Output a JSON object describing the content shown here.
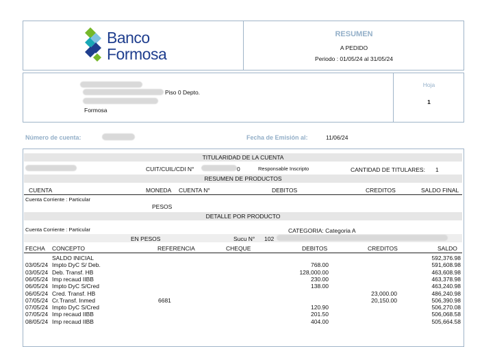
{
  "bank": {
    "line1": "Banco",
    "line2": "Formosa",
    "colors": {
      "blue": "#1f3e8e",
      "green": "#76b82a",
      "teal": "#19a7b5",
      "lightblue": "#7fc2e3"
    }
  },
  "summary": {
    "title": "RESUMEN",
    "subtitle": "A PEDIDO",
    "period": "Periodo : 01/05/24  al  31/05/24"
  },
  "address": {
    "floor": "Piso  0  Depto.",
    "city": "Formosa"
  },
  "sheet": {
    "label": "Hoja",
    "value": "1"
  },
  "account_info": {
    "account_label": "Número de cuenta:",
    "issue_label": "Fecha de Emisión al:",
    "issue_date": "11/06/24"
  },
  "ownership": {
    "title": "TITULARIDAD DE LA CUENTA",
    "cuit_label": "CUIT/CUIL/CDI N°",
    "cuit_tail": "0",
    "tax_status": "Responsable Inscripto",
    "holders_label": "CANTIDAD DE TITULARES:",
    "holders_value": "1"
  },
  "products_summary": {
    "title": "RESUMEN DE PRODUCTOS",
    "headers": {
      "account": "CUENTA",
      "currency": "MONEDA",
      "account_no": "CUENTA N°",
      "debits": "DEBITOS",
      "credits": "CREDITOS",
      "balance": "SALDO FINAL"
    },
    "account_type": "Cuenta Corriente : Particular",
    "currency": "PESOS"
  },
  "detail": {
    "title": "DETALLE POR PRODUCTO",
    "account_type": "Cuenta Corriente : Particular",
    "category": "CATEGORIA: Categoria A",
    "currency": "EN PESOS",
    "branch_label": "Sucu N°",
    "branch_value": "102",
    "headers": {
      "date": "FECHA",
      "concept": "CONCEPTO",
      "reference": "REFERENCIA",
      "check": "CHEQUE",
      "debits": "DEBITOS",
      "credits": "CREDITOS",
      "balance": "SALDO"
    },
    "rows": [
      {
        "date": "",
        "concept": "SALDO INICIAL",
        "ref": "",
        "debit": "",
        "credit": "",
        "balance": "592,376.98"
      },
      {
        "date": "03/05/24",
        "concept": "Impto DyC  S/ Deb.",
        "ref": "",
        "debit": "768.00",
        "credit": "",
        "balance": "591,608.98"
      },
      {
        "date": "03/05/24",
        "concept": "Deb. Transf. HB",
        "ref": "",
        "debit": "128,000.00",
        "credit": "",
        "balance": "463,608.98"
      },
      {
        "date": "06/05/24",
        "concept": "Imp recaud IIBB",
        "ref": "",
        "debit": "230.00",
        "credit": "",
        "balance": "463,378.98"
      },
      {
        "date": "06/05/24",
        "concept": "Impto DyC  S/Cred",
        "ref": "",
        "debit": "138.00",
        "credit": "",
        "balance": "463,240.98"
      },
      {
        "date": "06/05/24",
        "concept": "Cred. Transf. HB",
        "ref": "",
        "debit": "",
        "credit": "23,000.00",
        "balance": "486,240.98"
      },
      {
        "date": "07/05/24",
        "concept": "Cr.Transf. Inmed",
        "ref": "6681",
        "debit": "",
        "credit": "20,150.00",
        "balance": "506,390.98"
      },
      {
        "date": "07/05/24",
        "concept": "Impto DyC  S/Cred",
        "ref": "",
        "debit": "120.90",
        "credit": "",
        "balance": "506,270.08"
      },
      {
        "date": "07/05/24",
        "concept": "Imp recaud IIBB",
        "ref": "",
        "debit": "201.50",
        "credit": "",
        "balance": "506,068.58"
      },
      {
        "date": "08/05/24",
        "concept": "Imp recaud IIBB",
        "ref": "",
        "debit": "404.00",
        "credit": "",
        "balance": "505,664.58"
      }
    ]
  }
}
